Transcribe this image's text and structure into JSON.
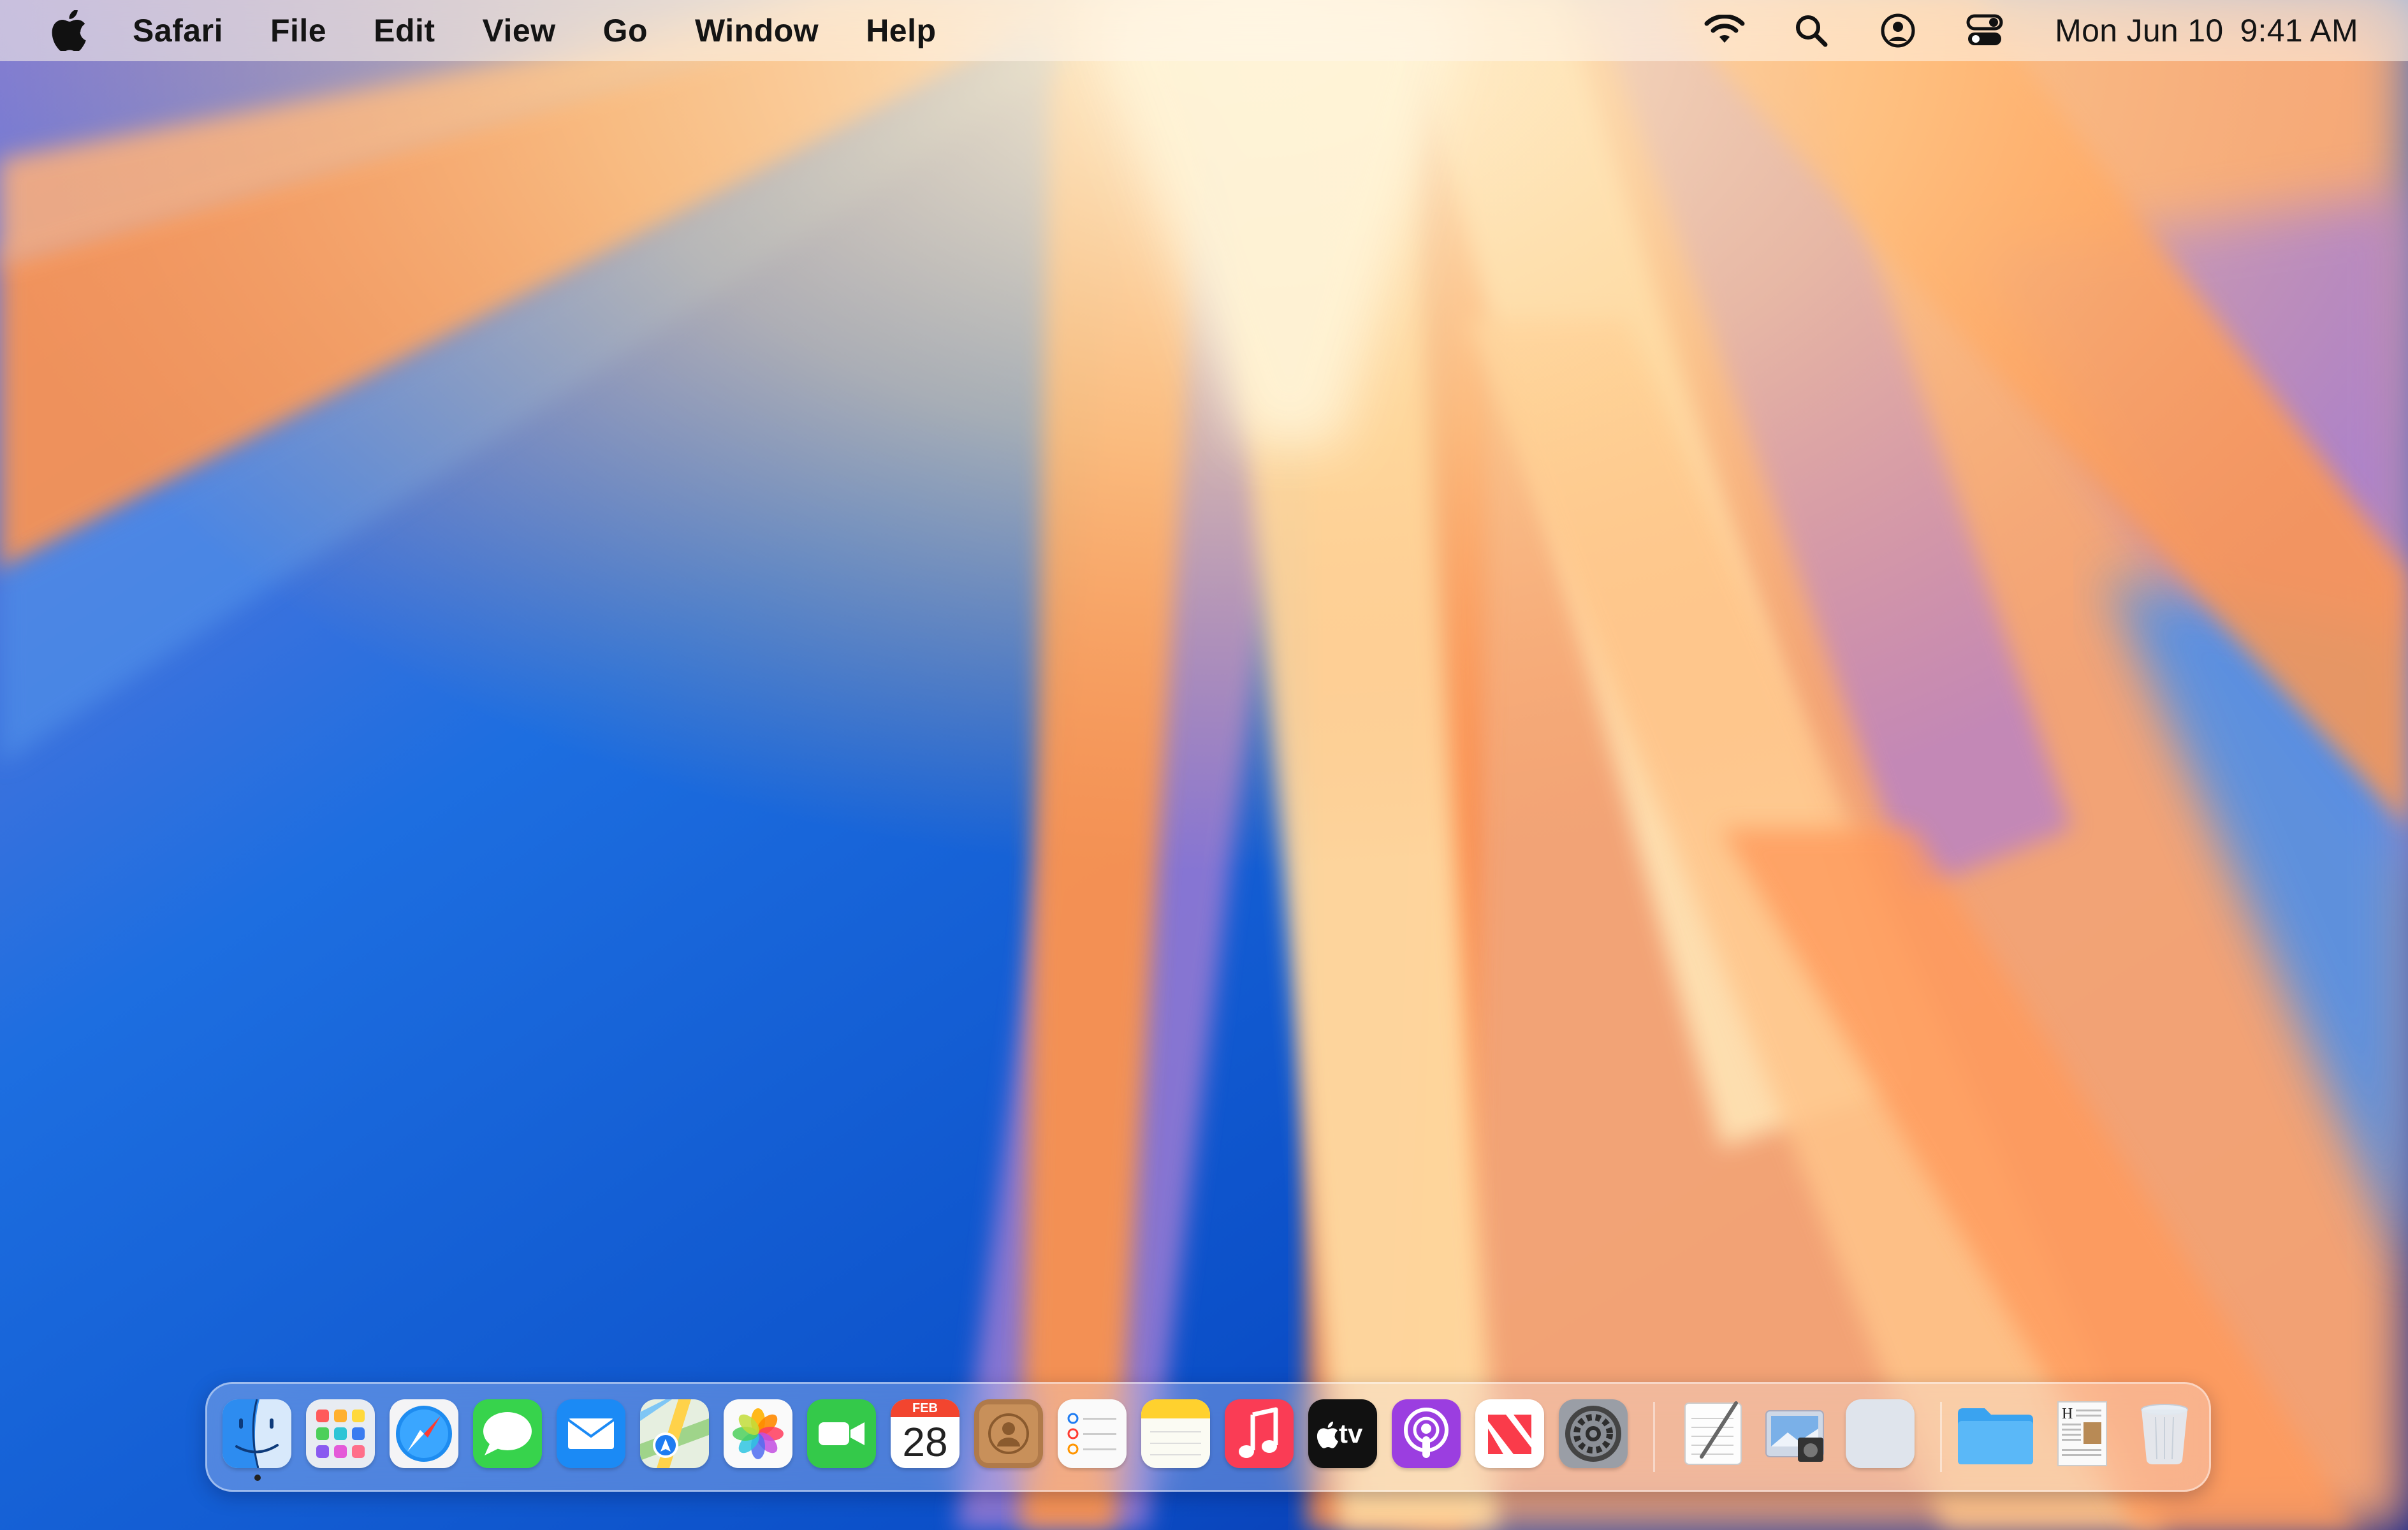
{
  "menubar": {
    "apple_icon": "apple-logo-icon",
    "app_name": "Safari",
    "menus": [
      "File",
      "Edit",
      "View",
      "Go",
      "Window",
      "Help"
    ],
    "status_icons": [
      "wifi-icon",
      "search-icon",
      "user-account-icon",
      "control-center-icon"
    ],
    "date": "Mon Jun 10",
    "time": "9:41 AM"
  },
  "dock": {
    "apps": [
      {
        "name": "Finder",
        "icon": "finder-icon",
        "running": true
      },
      {
        "name": "Launchpad",
        "icon": "launchpad-icon"
      },
      {
        "name": "Safari",
        "icon": "safari-icon"
      },
      {
        "name": "Messages",
        "icon": "messages-icon"
      },
      {
        "name": "Mail",
        "icon": "mail-icon"
      },
      {
        "name": "Maps",
        "icon": "maps-icon"
      },
      {
        "name": "Photos",
        "icon": "photos-icon"
      },
      {
        "name": "FaceTime",
        "icon": "facetime-icon"
      },
      {
        "name": "Calendar",
        "icon": "calendar-icon",
        "month": "FEB",
        "day": "28"
      },
      {
        "name": "Contacts",
        "icon": "contacts-icon"
      },
      {
        "name": "Reminders",
        "icon": "reminders-icon"
      },
      {
        "name": "Notes",
        "icon": "notes-icon"
      },
      {
        "name": "Music",
        "icon": "music-icon"
      },
      {
        "name": "TV",
        "icon": "apple-tv-icon",
        "label": "tv"
      },
      {
        "name": "Podcasts",
        "icon": "podcasts-icon"
      },
      {
        "name": "News",
        "icon": "news-icon"
      },
      {
        "name": "System Settings",
        "icon": "system-settings-icon"
      }
    ],
    "recent_apps": [
      {
        "name": "TextEdit",
        "icon": "textedit-icon"
      },
      {
        "name": "Preview",
        "icon": "preview-icon"
      },
      {
        "name": "Blank App",
        "icon": "blank-app-icon"
      }
    ],
    "stacks": [
      {
        "name": "Folder",
        "icon": "folder-icon"
      },
      {
        "name": "Document",
        "icon": "document-icon"
      },
      {
        "name": "Trash",
        "icon": "trash-icon"
      }
    ]
  },
  "colors": {
    "menubar_bg": "#fff5eb",
    "wallpaper_blue": "#0a5ad6",
    "wallpaper_orange": "#ff9d4d",
    "wallpaper_peach": "#ffe0a8",
    "wallpaper_violet": "#9a72d0"
  }
}
